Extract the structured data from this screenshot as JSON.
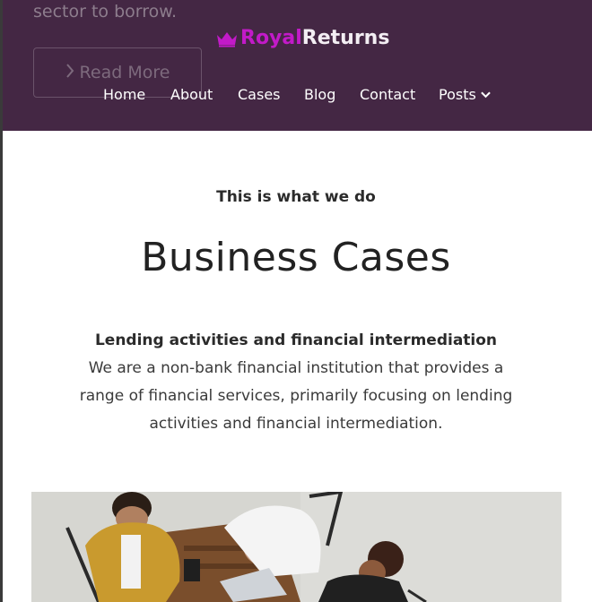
{
  "hero": {
    "text_fragment": "sector to borrow.",
    "read_more_label": "Read More"
  },
  "brand": {
    "part1": "Royal",
    "part2": "Returns",
    "icon": "crown-icon",
    "colors": {
      "part1": "#c21ac8",
      "part2": "#f3eef3"
    }
  },
  "nav": {
    "items": [
      {
        "label": "Home"
      },
      {
        "label": "About"
      },
      {
        "label": "Cases"
      },
      {
        "label": "Blog"
      },
      {
        "label": "Contact"
      },
      {
        "label": "Posts",
        "icon": "chevron-down-icon"
      }
    ]
  },
  "section": {
    "eyebrow": "This is what we do",
    "title": "Business Cases",
    "subtitle": "Lending activities and financial intermediation",
    "paragraph": "We are a non-bank financial institution that provides a range of financial services, primarily focusing on lending activities and financial intermediation."
  },
  "colors": {
    "header_bg": "#3e203e",
    "accent": "#c21ac8"
  }
}
